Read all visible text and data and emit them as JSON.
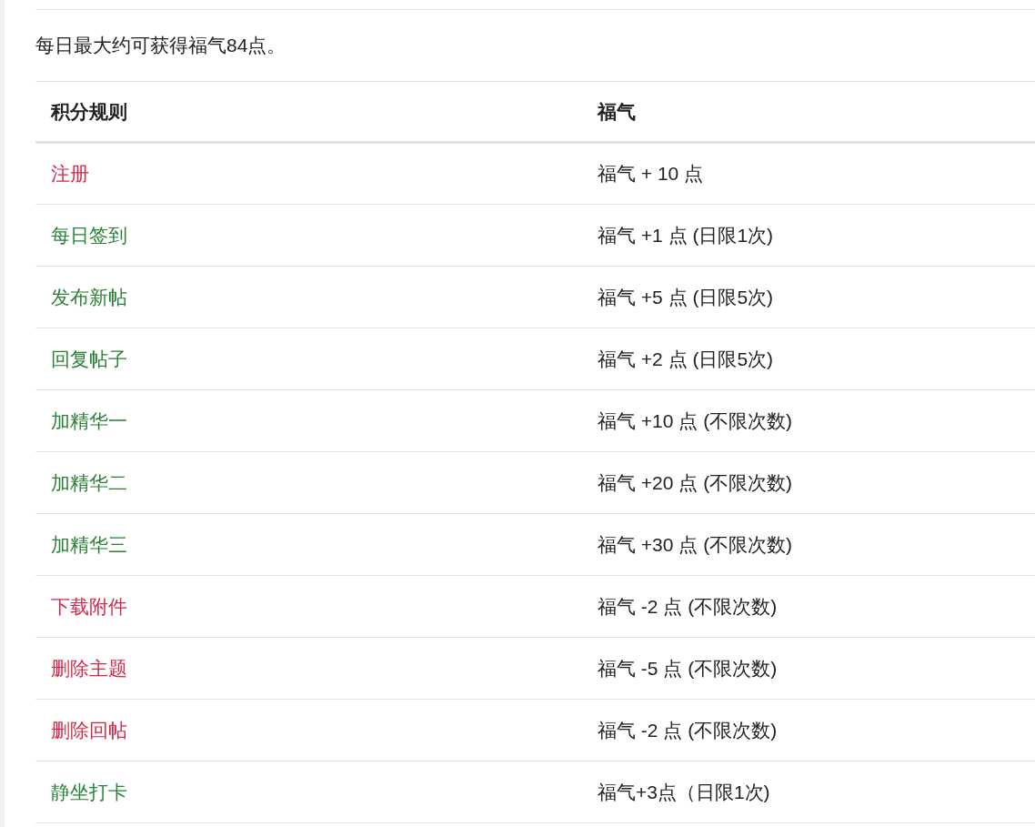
{
  "intro": "每日最大约可获得福气84点。",
  "table": {
    "columns": [
      "积分规则",
      "福气"
    ],
    "rows": [
      {
        "rule": "注册",
        "color": "#d3294a",
        "points": "福气 + 10 点"
      },
      {
        "rule": "每日签到",
        "color": "#2a8236",
        "points": "福气 +1 点 (日限1次)"
      },
      {
        "rule": "发布新帖",
        "color": "#2a8236",
        "points": "福气 +5 点 (日限5次)"
      },
      {
        "rule": "回复帖子",
        "color": "#2a8236",
        "points": "福气 +2 点 (日限5次)"
      },
      {
        "rule": "加精华一",
        "color": "#2a8236",
        "points": "福气 +10 点 (不限次数)"
      },
      {
        "rule": "加精华二",
        "color": "#2a8236",
        "points": "福气 +20 点 (不限次数)"
      },
      {
        "rule": "加精华三",
        "color": "#2a8236",
        "points": "福气 +30 点 (不限次数)"
      },
      {
        "rule": "下载附件",
        "color": "#d3294a",
        "points": "福气 -2 点 (不限次数)"
      },
      {
        "rule": "删除主题",
        "color": "#d3294a",
        "points": "福气 -5 点 (不限次数)"
      },
      {
        "rule": "删除回帖",
        "color": "#d3294a",
        "points": "福气 -2 点 (不限次数)"
      },
      {
        "rule": "静坐打卡",
        "color": "#2a8236",
        "points": "福气+3点（日限1次)"
      }
    ]
  }
}
